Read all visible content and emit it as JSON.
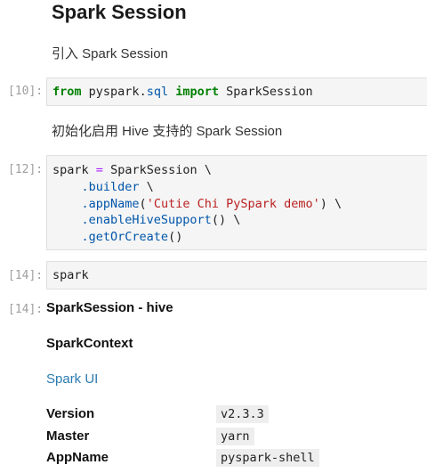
{
  "heading": "Spark Session",
  "intro_text": "引入 Spark Session",
  "init_text": "初始化启用 Hive 支持的 Spark Session",
  "cells": {
    "c10": {
      "prompt": "[10]:",
      "kw_from": "from",
      "module_a": "pyspark",
      "dot": ".",
      "module_b": "sql",
      "kw_import": "import",
      "name": "SparkSession"
    },
    "c12": {
      "prompt": "[12]:",
      "l1_var": "spark",
      "l1_eq": "=",
      "l1_cls": "SparkSession \\",
      "l2_method": ".builder",
      "l2_tail": " \\",
      "l3_method": ".appName",
      "l3_open": "(",
      "l3_str": "'Cutie Chi PySpark demo'",
      "l3_close": ") \\",
      "l4_method": ".enableHiveSupport",
      "l4_tail": "() \\",
      "l5_method": ".getOrCreate",
      "l5_tail": "()"
    },
    "c14": {
      "prompt": "[14]:",
      "code": "spark"
    }
  },
  "output": {
    "prompt": "[14]:",
    "session_title": "SparkSession - hive",
    "context_title": "SparkContext",
    "spark_ui_link": "Spark UI",
    "rows": [
      {
        "key": "Version",
        "value": "v2.3.3"
      },
      {
        "key": "Master",
        "value": "yarn"
      },
      {
        "key": "AppName",
        "value": "pyspark-shell"
      }
    ]
  }
}
